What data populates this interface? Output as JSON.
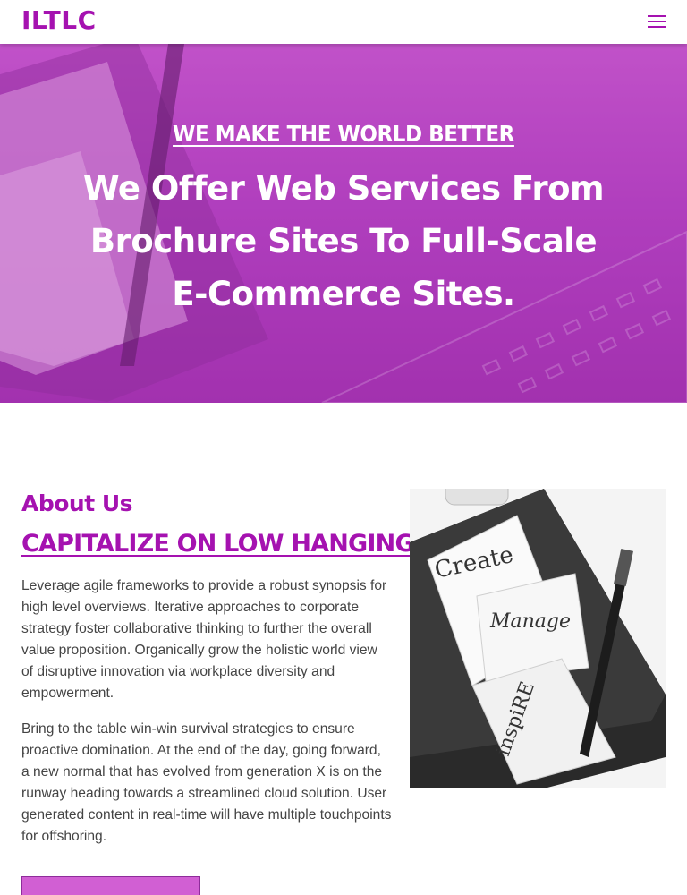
{
  "brand": {
    "name": "ILTLC",
    "accent": "#a512b0",
    "hero_tint": "#b33fc0",
    "button_fill": "#d15fd3"
  },
  "header": {
    "menu_icon": "hamburger-menu-icon"
  },
  "hero": {
    "eyebrow": "WE MAKE THE WORLD BETTER",
    "title": "We Offer Web Services From Brochure Sites To Full-Scale E-Commerce Sites."
  },
  "about": {
    "label": "About Us",
    "heading": "CAPITALIZE ON LOW HANGING",
    "paragraphs": [
      "Leverage agile frameworks to provide a robust synopsis for high level overviews. Iterative approaches to corporate strategy foster collaborative thinking to further the overall value proposition. Organically grow the holistic world view of disruptive innovation via workplace diversity and empowerment.",
      "Bring to the table win-win survival strategies to ensure proactive domination. At the end of the day, going forward, a new normal that has evolved from generation X is on the runway heading towards a streamlined cloud solution. User generated content in real-time will have multiple touchpoints for offshoring."
    ],
    "image_words": [
      "Create",
      "Manage",
      "inspiRE"
    ]
  }
}
